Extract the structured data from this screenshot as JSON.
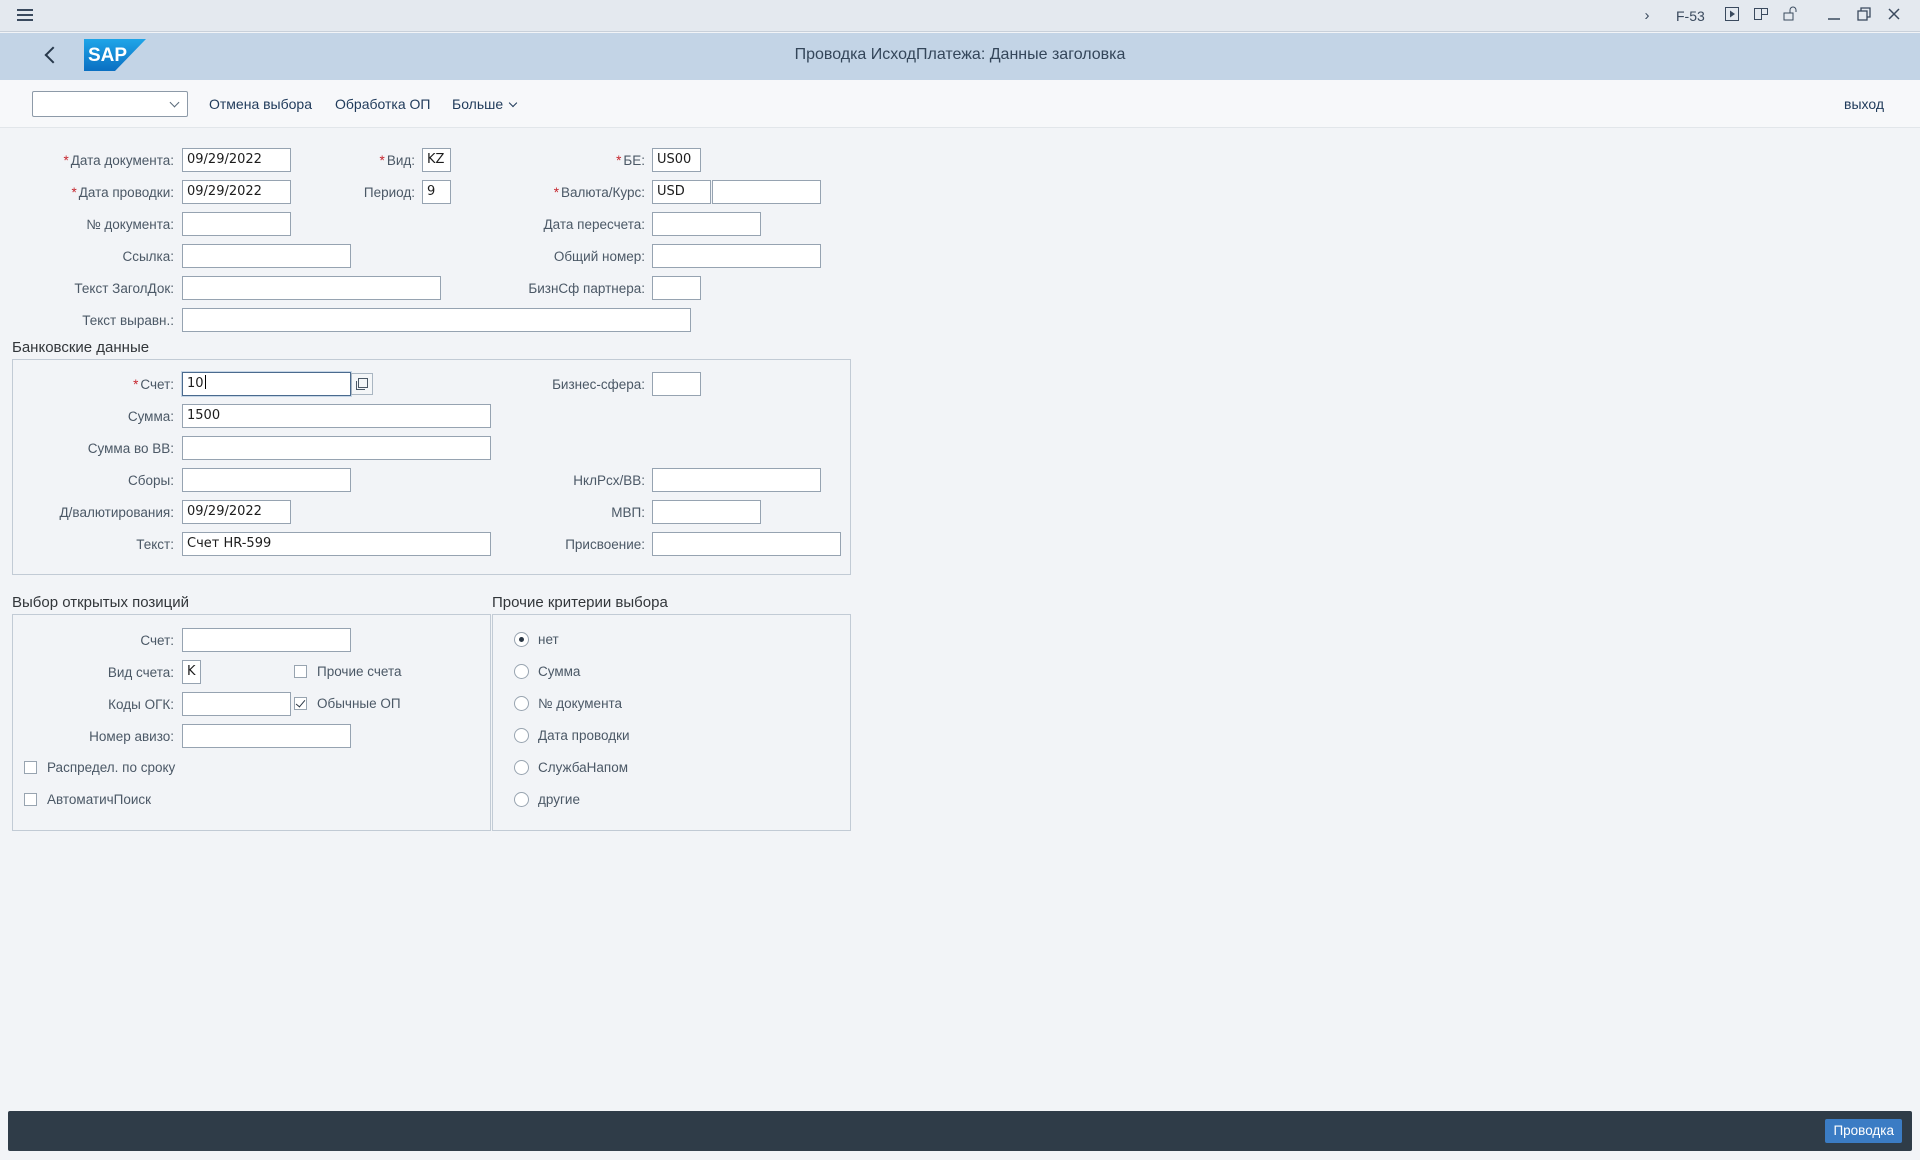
{
  "titlebar": {
    "tcode": "F-53"
  },
  "shell": {
    "title": "Проводка ИсходПлатежа: Данные заголовка"
  },
  "toolbar": {
    "cancel_selection": "Отмена выбора",
    "process_op": "Обработка ОП",
    "more": "Больше",
    "exit": "выход"
  },
  "header": {
    "doc_date_label": "Дата документа:",
    "doc_date": "09/29/2022",
    "post_date_label": "Дата проводки:",
    "post_date": "09/29/2022",
    "doc_no_label": "№ документа:",
    "doc_no": "",
    "reference_label": "Ссылка:",
    "reference": "",
    "header_text_label": "Текст ЗаголДок:",
    "header_text": "",
    "clearing_text_label": "Текст выравн.:",
    "clearing_text": "",
    "type_label": "Вид:",
    "type": "KZ",
    "period_label": "Период:",
    "period": "9",
    "company_label": "БЕ:",
    "company": "US00",
    "currency_label": "Валюта/Курс:",
    "currency": "USD",
    "rate": "",
    "translation_date_label": "Дата пересчета:",
    "translation_date": "",
    "cross_cc_label": "Общий номер:",
    "cross_cc": "",
    "partner_ba_label": "БизнСф партнера:",
    "partner_ba": ""
  },
  "bank": {
    "title": "Банковские данные",
    "account_label": "Счет:",
    "account": "10",
    "amount_label": "Сумма:",
    "amount": "1500",
    "amount_lc_label": "Сумма во ВВ:",
    "amount_lc": "",
    "charges_label": "Сборы:",
    "charges": "",
    "value_date_label": "Д/валютирования:",
    "value_date": "09/29/2022",
    "text_label": "Текст:",
    "text": "Счет HR-599",
    "business_area_label": "Бизнес-сфера:",
    "business_area": "",
    "lc_bank_charges_label": "НклРсх/ВВ:",
    "lc_bank_charges": "",
    "profit_center_label": "МВП:",
    "profit_center": "",
    "assignment_label": "Присвоение:",
    "assignment": ""
  },
  "open_items": {
    "title": "Выбор открытых позиций",
    "account_label": "Счет:",
    "account": "",
    "account_type_label": "Вид счета:",
    "account_type": "K",
    "other_accounts": "Прочие счета",
    "other_accounts_checked": false,
    "special_gl_label": "Коды ОГК:",
    "special_gl": "",
    "normal_oi": "Обычные ОП",
    "normal_oi_checked": true,
    "payment_advice_label": "Номер авизо:",
    "payment_advice": "",
    "distribute_by_age": "Распредел. по сроку",
    "auto_search": "АвтоматичПоиск"
  },
  "other_criteria": {
    "title": "Прочие критерии выбора",
    "options": [
      "нет",
      "Сумма",
      "№ документа",
      "Дата проводки",
      "СлужбаНапом",
      "другие"
    ],
    "selected": "нет"
  },
  "footer": {
    "post_button": "Проводка"
  }
}
